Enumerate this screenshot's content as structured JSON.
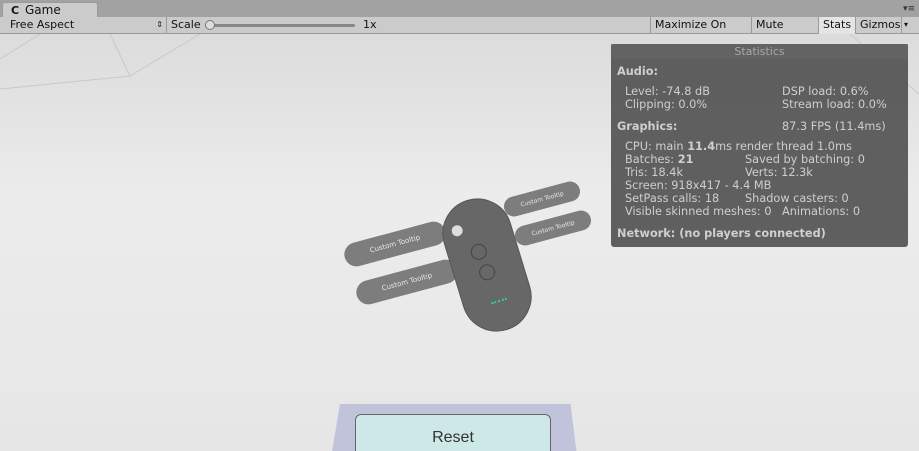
{
  "tab": {
    "title": "Game"
  },
  "toolbar": {
    "aspect": "Free Aspect",
    "scale_label": "Scale",
    "scale_value": "1x",
    "scale_fraction": 0,
    "maximize": "Maximize On Play",
    "mute": "Mute Audio",
    "stats": "Stats",
    "gizmos": "Gizmos"
  },
  "stats": {
    "title": "Statistics",
    "audio": "Audio:",
    "level": "Level: -74.8 dB",
    "dsp": "DSP load: 0.6%",
    "clipping": "Clipping: 0.0%",
    "stream": "Stream load: 0.0%",
    "graphics": "Graphics:",
    "fps": "87.3 FPS (11.4ms)",
    "cpu_prefix": "CPU: main ",
    "cpu_main": "11.4",
    "cpu_suffix": "ms  render thread 1.0ms",
    "batches_prefix": "Batches: ",
    "batches": "21",
    "saved": "Saved by batching: 0",
    "tris": "Tris: 18.4k",
    "verts": "Verts: 12.3k",
    "screen": "Screen: 918x417 - 4.4 MB",
    "setpass": "SetPass calls: 18",
    "shadow": "Shadow casters: 0",
    "skinned": "Visible skinned meshes: 0",
    "animations": "Animations: 0",
    "network": "Network: (no players connected)"
  },
  "scene": {
    "tooltips": [
      "Custom Tooltip",
      "Custom Tooltip",
      "Custom Tooltip",
      "Custom Tooltip"
    ],
    "reset": "Reset"
  }
}
